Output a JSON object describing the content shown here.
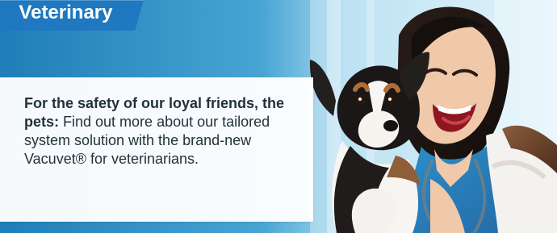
{
  "banner": {
    "category_label": "Veterinary",
    "headline_text": "For the safety of our loyal friends, the pets:",
    "body_text": " Find out more about our tailored system solution with the brand-new Vacuvet® for veterinarians.",
    "colors": {
      "category_background": "#1f78c0",
      "category_text": "#ffffff",
      "card_background": "#ffffff",
      "copy_text": "#23323a",
      "scrub_blue": "#2f79b9"
    },
    "image": {
      "subject": "veterinarian holding a puppy and laughing",
      "icon": "veterinary-photo-illustration"
    }
  }
}
